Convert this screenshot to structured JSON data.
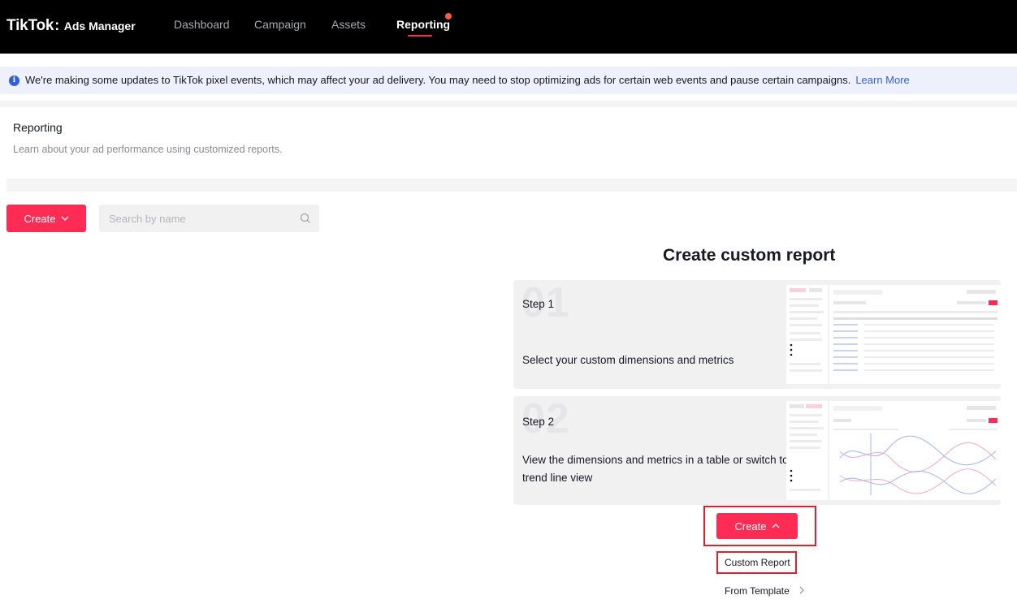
{
  "topbar": {
    "brand_main": "TikTok",
    "brand_sep": ":",
    "brand_sub": "Ads Manager",
    "nav": [
      "Dashboard",
      "Campaign",
      "Assets",
      "Reporting"
    ],
    "active_nav": "Reporting"
  },
  "notice": {
    "text": "We're making some updates to TikTok pixel events, which may affect your ad delivery. You may need to stop optimizing ads for certain web events and pause certain campaigns.",
    "link": "Learn More"
  },
  "page": {
    "title": "Reporting",
    "subtitle": "Learn about your ad performance using customized reports."
  },
  "toolbar": {
    "create_label": "Create",
    "search_placeholder": "Search by name"
  },
  "custom_report": {
    "title": "Create custom report",
    "steps": [
      {
        "num": "01",
        "label": "Step 1",
        "desc": "Select your custom dimensions and metrics"
      },
      {
        "num": "02",
        "label": "Step 2",
        "desc": "View the dimensions and metrics in a table or switch to trend line view"
      }
    ],
    "create_label": "Create",
    "dropdown": [
      "Custom Report",
      "From Template"
    ]
  },
  "colors": {
    "brand": "#fe2c55",
    "topbar": "#000000",
    "notice_bg": "#eef1fb",
    "link": "#2f5fe0",
    "highlight": "#e5202e",
    "nav_dot": "#ff5c3b"
  },
  "icons": [
    "info-icon",
    "chevron-down-icon",
    "search-icon",
    "chevron-up-icon",
    "chevron-right-icon"
  ]
}
